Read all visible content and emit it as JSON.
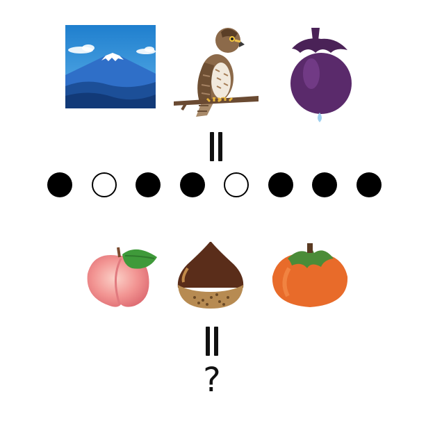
{
  "top_row": {
    "items": [
      {
        "name": "mount-fuji",
        "icon": "mount-fuji-icon"
      },
      {
        "name": "hawk",
        "icon": "hawk-icon"
      },
      {
        "name": "eggplant",
        "icon": "eggplant-icon"
      }
    ]
  },
  "code": {
    "sequence": [
      "filled",
      "hollow",
      "filled",
      "filled",
      "hollow",
      "filled",
      "filled",
      "filled"
    ]
  },
  "bottom_row": {
    "items": [
      {
        "name": "peach",
        "icon": "peach-icon"
      },
      {
        "name": "chestnut",
        "icon": "chestnut-icon"
      },
      {
        "name": "persimmon",
        "icon": "persimmon-icon"
      }
    ]
  },
  "answer": {
    "text": "?"
  }
}
